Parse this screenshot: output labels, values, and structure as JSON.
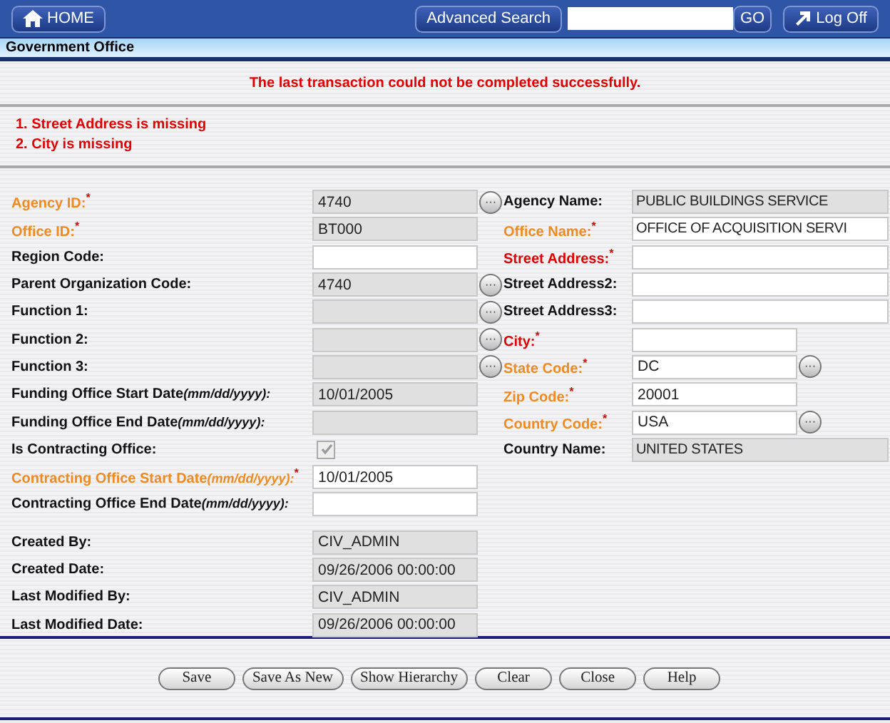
{
  "header": {
    "home": "HOME",
    "advanced_search": "Advanced Search",
    "go": "GO",
    "logoff": "Log Off"
  },
  "title": "Government Office",
  "message": "The last transaction could not be completed successfully.",
  "errors": [
    "1. Street Address is missing",
    "2. City is missing"
  ],
  "left_groups": [
    {
      "rows": [
        {
          "kind": "field",
          "label": "Agency ID:",
          "required": true,
          "error": false,
          "mark": "*",
          "value": "4740",
          "readonly": true,
          "lookup": true
        },
        {
          "kind": "field",
          "label": "Office ID:",
          "required": true,
          "error": false,
          "mark": "*",
          "value": "BT000",
          "readonly": true,
          "lookup": false
        },
        {
          "kind": "field",
          "label": "Region Code:",
          "required": false,
          "error": false,
          "readonly": false,
          "lookup": false
        },
        {
          "kind": "field",
          "label": "Parent Organization Code:",
          "required": false,
          "error": false,
          "value": "4740",
          "readonly": true,
          "lookup": true
        },
        {
          "kind": "field",
          "label": "Function 1:",
          "required": false,
          "error": false,
          "readonly": true,
          "lookup": true
        },
        {
          "kind": "field",
          "label": "Function 2:",
          "required": false,
          "error": false,
          "readonly": true,
          "lookup": true
        },
        {
          "kind": "field",
          "label": "Function 3:",
          "required": false,
          "error": false,
          "readonly": true,
          "lookup": true
        },
        {
          "kind": "field",
          "label": "Funding Office Start Date",
          "hint": "(mm/dd/yyyy):",
          "required": false,
          "error": false,
          "value": "10/01/2005",
          "readonly": true,
          "lookup": false
        },
        {
          "kind": "field",
          "label": "Funding Office End Date",
          "hint": "(mm/dd/yyyy):",
          "required": false,
          "error": false,
          "readonly": true,
          "lookup": false
        },
        {
          "kind": "checkbox",
          "label": "Is Contracting Office:",
          "required": false,
          "error": false,
          "checked": true,
          "disabled": true
        },
        {
          "kind": "field",
          "label": "Contracting Office Start Date",
          "hint": "(mm/dd/yyyy):",
          "required": true,
          "error": false,
          "mark": "*",
          "value": "10/01/2005",
          "readonly": false,
          "lookup": false
        },
        {
          "kind": "field",
          "label": "Contracting Office End Date",
          "hint": "(mm/dd/yyyy):",
          "required": false,
          "error": false,
          "readonly": false,
          "lookup": false
        }
      ]
    },
    {
      "rows": [
        {
          "kind": "field",
          "label": "Created By:",
          "required": false,
          "error": false,
          "value": "CIV_ADMIN",
          "readonly": true,
          "lookup": false
        },
        {
          "kind": "field",
          "label": "Created Date:",
          "required": false,
          "error": false,
          "value": "09/26/2006 00:00:00",
          "readonly": true,
          "lookup": false
        },
        {
          "kind": "field",
          "label": "Last Modified By:",
          "required": false,
          "error": false,
          "value": "CIV_ADMIN",
          "readonly": true,
          "lookup": false
        },
        {
          "kind": "field",
          "label": "Last Modified Date:",
          "required": false,
          "error": false,
          "value": "09/26/2006 00:00:00",
          "readonly": true,
          "lookup": false
        }
      ]
    }
  ],
  "right_rows": [
    {
      "kind": "field",
      "label": "Agency Name:",
      "required": false,
      "error": false,
      "value": "PUBLIC BUILDINGS SERVICE",
      "readonly": true,
      "lookup": false,
      "wide": true
    },
    {
      "kind": "field",
      "label": "Office Name:",
      "required": true,
      "error": false,
      "mark": "*",
      "value": "OFFICE OF ACQUISITION SERVI",
      "readonly": false,
      "lookup": false,
      "wide": true
    },
    {
      "kind": "field",
      "label": "Street Address:",
      "required": true,
      "error": true,
      "mark": "*",
      "readonly": false,
      "lookup": false,
      "wide": true
    },
    {
      "kind": "field",
      "label": "Street Address2:",
      "required": false,
      "error": false,
      "readonly": false,
      "lookup": false,
      "wide": true
    },
    {
      "kind": "field",
      "label": "Street Address3:",
      "required": false,
      "error": false,
      "readonly": false,
      "lookup": false,
      "wide": true
    },
    {
      "kind": "field",
      "label": "City:",
      "required": true,
      "error": true,
      "mark": "*",
      "readonly": false,
      "lookup": false,
      "wide": false
    },
    {
      "kind": "field",
      "label": "State Code:",
      "required": true,
      "error": false,
      "mark": "*",
      "value": "DC",
      "readonly": false,
      "lookup": true,
      "wide": false
    },
    {
      "kind": "field",
      "label": "Zip Code:",
      "required": true,
      "error": false,
      "mark": "*",
      "value": "20001",
      "readonly": false,
      "lookup": false,
      "wide": false
    },
    {
      "kind": "field",
      "label": "Country Code:",
      "required": true,
      "error": false,
      "mark": "*",
      "value": "USA",
      "readonly": false,
      "lookup": true,
      "wide": false
    },
    {
      "kind": "field",
      "label": "Country Name:",
      "required": false,
      "error": false,
      "value": "UNITED STATES",
      "readonly": true,
      "lookup": false,
      "wide": true
    }
  ],
  "buttons": [
    "Save",
    "Save As New",
    "Show Hierarchy",
    "Clear",
    "Close",
    "Help"
  ],
  "lookup_glyph": "···"
}
